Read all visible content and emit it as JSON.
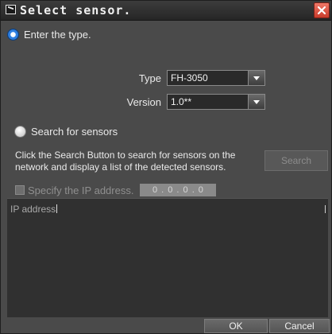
{
  "window": {
    "title": "Select sensor.",
    "close_icon": "close-icon",
    "accent_color": "#d9473a"
  },
  "type_option": {
    "label": "Enter the type.",
    "selected": true
  },
  "type_field": {
    "label": "Type",
    "value": "FH-3050"
  },
  "version_field": {
    "label": "Version",
    "value": "1.0**"
  },
  "search_option": {
    "label": "Search for sensors",
    "selected": false
  },
  "search_description": "Click the Search Button to search for sensors on the network and display a list of the detected sensors.",
  "search_button": {
    "label": "Search",
    "enabled": false
  },
  "ip_filter": {
    "label": "Specify the IP address.",
    "checked": false,
    "value": "0 . 0 . 0 . 0"
  },
  "results_list": {
    "column_header": "IP address",
    "rows": []
  },
  "buttons": {
    "ok": "OK",
    "cancel": "Cancel"
  }
}
